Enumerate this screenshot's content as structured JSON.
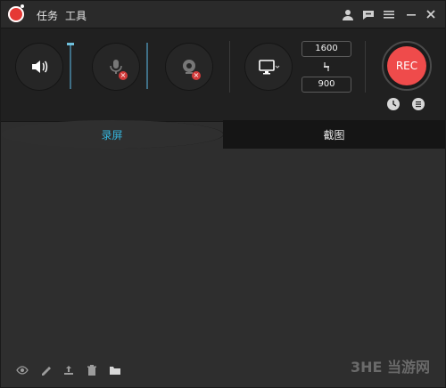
{
  "menu": {
    "task_label": "任务",
    "tool_label": "工具"
  },
  "title_icons": {
    "user_icon": "user-icon",
    "chat_icon": "chat-icon",
    "menu_icon": "menu-icon",
    "minimize_icon": "minimize-icon",
    "close_icon": "close-icon"
  },
  "controls": {
    "speaker_icon": "speaker-icon",
    "mic_icon": "microphone-icon",
    "webcam_icon": "webcam-icon",
    "screen_icon": "monitor-icon",
    "width_value": "1600",
    "height_value": "900",
    "link_icon": "link-icon",
    "rec_label": "REC",
    "timer_icon": "clock-icon",
    "settings_icon": "list-settings-icon"
  },
  "tabs": {
    "record_label": "录屏",
    "capture_label": "截图"
  },
  "bottom": {
    "eye_icon": "eye-icon",
    "brush_icon": "brush-icon",
    "upload_icon": "upload-icon",
    "trash_icon": "trash-icon",
    "folder_icon": "folder-icon"
  },
  "watermark_text": "3HE 当游网",
  "colors": {
    "accent_blue": "#35b7df",
    "rec_red": "#ef4b4b",
    "dark_bg": "#202020"
  }
}
